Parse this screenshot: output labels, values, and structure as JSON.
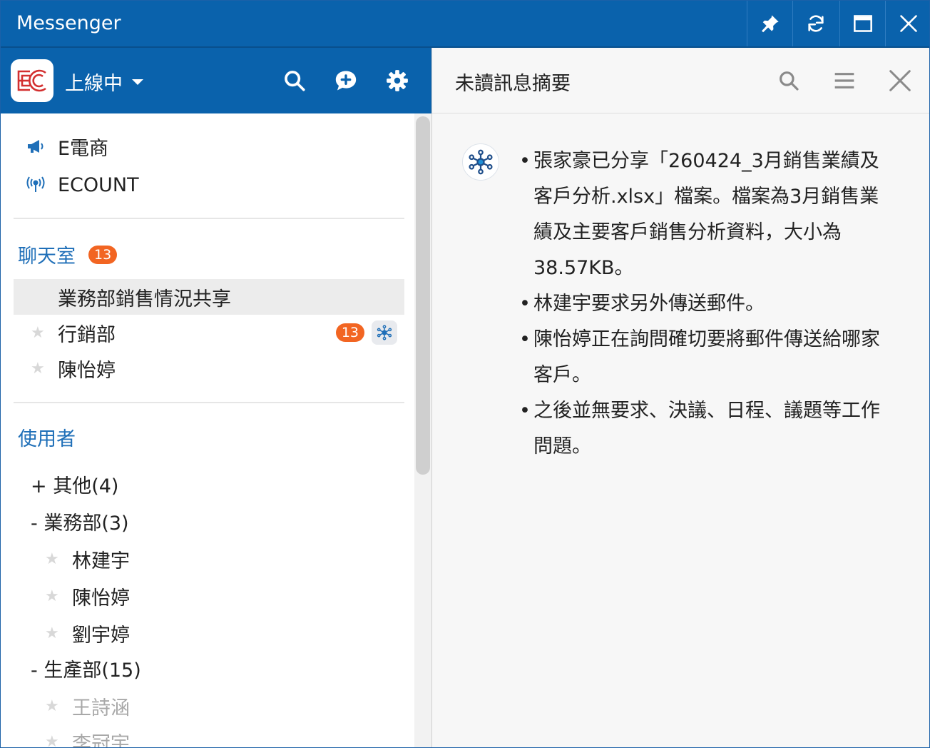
{
  "window": {
    "title": "Messenger"
  },
  "header": {
    "status": "上線中"
  },
  "notices": [
    {
      "label": "E電商"
    },
    {
      "label": "ECOUNT"
    }
  ],
  "chatrooms": {
    "title": "聊天室",
    "badge": "13",
    "items": [
      {
        "name": "業務部銷售情況共享",
        "badge": ""
      },
      {
        "name": "行銷部",
        "badge": "13"
      },
      {
        "name": "陳怡婷",
        "badge": ""
      }
    ]
  },
  "users": {
    "title": "使用者",
    "groups": [
      {
        "label": "+ 其他(4)"
      },
      {
        "label": "- 業務部(3)",
        "members": [
          "林建宇",
          "陳怡婷",
          "劉宇婷"
        ]
      },
      {
        "label": "- 生產部(15)",
        "members": [
          "王詩涵",
          "李冠宇"
        ]
      }
    ]
  },
  "right_panel": {
    "title": "未讀訊息摘要",
    "summary": [
      "張家豪已分享「260424_3月銷售業績及客戶分析.xlsx」檔案。檔案為3月銷售業績及主要客戶銷售分析資料，大小為38.57KB。",
      "林建宇要求另外傳送郵件。",
      "陳怡婷正在詢問確切要將郵件傳送給哪家客戶。",
      "之後並無要求、決議、日程、議題等工作問題。"
    ]
  },
  "colors": {
    "brand_blue": "#0a62ac",
    "badge_orange": "#f26522",
    "section_blue": "#1f6fb8"
  }
}
